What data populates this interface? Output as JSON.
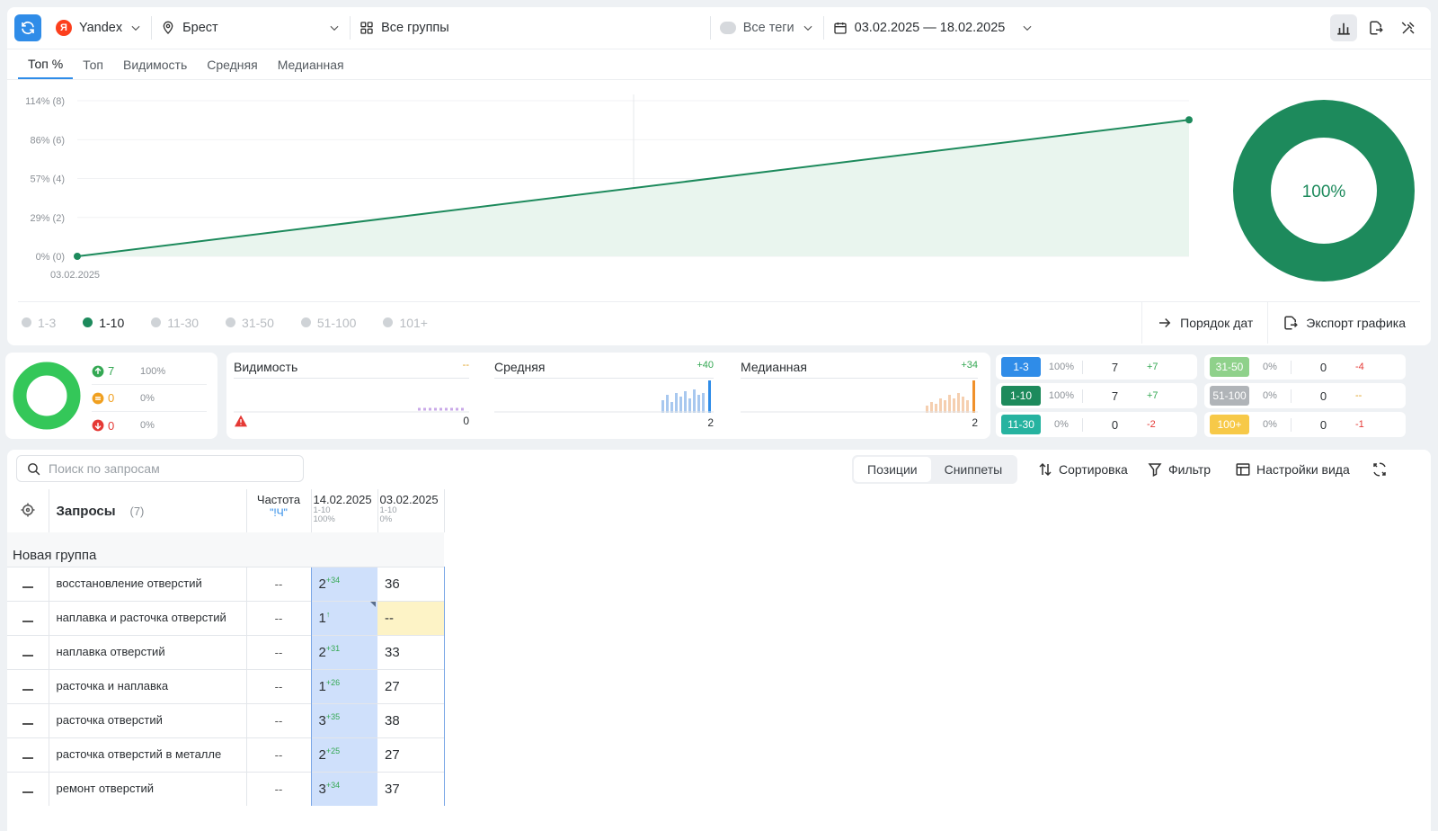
{
  "topbar": {
    "engine": "Yandex",
    "engine_logo": "Я",
    "region": "Брест",
    "groups": "Все группы",
    "tags": "Все теги",
    "date_range": "03.02.2025 — 18.02.2025"
  },
  "chart_tabs": [
    "Топ %",
    "Топ",
    "Видимость",
    "Средняя",
    "Медианная"
  ],
  "chart_data": {
    "type": "area",
    "y_ticks": [
      "114% (8)",
      "86% (6)",
      "57% (4)",
      "29% (2)",
      "0% (0)"
    ],
    "x_label_first": "03.02.2025",
    "series": [
      {
        "values": [
          0,
          100
        ]
      }
    ],
    "ylim": [
      0,
      114
    ],
    "color": "#1d8a5c",
    "donut_value": "100%"
  },
  "legend": {
    "items": [
      {
        "label": "1-3",
        "active": false
      },
      {
        "label": "1-10",
        "active": true
      },
      {
        "label": "11-30",
        "active": false
      },
      {
        "label": "31-50",
        "active": false
      },
      {
        "label": "51-100",
        "active": false
      },
      {
        "label": "101+",
        "active": false
      }
    ],
    "date_order": "Порядок дат",
    "export": "Экспорт графика"
  },
  "summary": {
    "up_count": "7",
    "up_pct": "100%",
    "same_count": "0",
    "same_pct": "0%",
    "down_count": "0",
    "down_pct": "0%"
  },
  "metrics": {
    "visibility": {
      "title": "Видимость",
      "delta": "--",
      "value": "0"
    },
    "average": {
      "title": "Средняя",
      "delta": "+40",
      "value": "2"
    },
    "median": {
      "title": "Медианная",
      "delta": "+34",
      "value": "2"
    }
  },
  "ranges": [
    {
      "label": "1-3",
      "pct": "100%",
      "count": "7",
      "delta": "+7",
      "color": "#2f8ce8",
      "delta_color": "#34a853"
    },
    {
      "label": "1-10",
      "pct": "100%",
      "count": "7",
      "delta": "+7",
      "color": "#1d8a5c",
      "delta_color": "#34a853"
    },
    {
      "label": "11-30",
      "pct": "0%",
      "count": "0",
      "delta": "-2",
      "color": "#26b3a0",
      "delta_color": "#e53935"
    },
    {
      "label": "31-50",
      "pct": "0%",
      "count": "0",
      "delta": "-4",
      "color": "#8fd18b",
      "delta_color": "#e53935"
    },
    {
      "label": "51-100",
      "pct": "0%",
      "count": "0",
      "delta": "--",
      "color": "#b0b4b8",
      "delta_color": "#e0a020"
    },
    {
      "label": "100+",
      "pct": "0%",
      "count": "0",
      "delta": "-1",
      "color": "#f7c948",
      "delta_color": "#e53935"
    }
  ],
  "table_toolbar": {
    "search_placeholder": "Поиск по запросам",
    "seg_positions": "Позиции",
    "seg_snippets": "Сниппеты",
    "sort": "Сортировка",
    "filter": "Фильтр",
    "view_settings": "Настройки вида"
  },
  "table": {
    "queries_label": "Запросы",
    "queries_count": "(7)",
    "freq_label": "Частота",
    "freq_sub": "\"!Ч\"",
    "col1_date": "14.02.2025",
    "col1_range": "1-10",
    "col1_pct": "100%",
    "col2_date": "03.02.2025",
    "col2_range": "1-10",
    "col2_pct": "0%",
    "group_name": "Новая группа",
    "rows": [
      {
        "query": "восстановление отверстий",
        "freq": "--",
        "pos": "2",
        "change": "+34",
        "prev": "36"
      },
      {
        "query": "наплавка и расточка отверстий",
        "freq": "--",
        "pos": "1",
        "change": "↑",
        "prev": "--"
      },
      {
        "query": "наплавка отверстий",
        "freq": "--",
        "pos": "2",
        "change": "+31",
        "prev": "33"
      },
      {
        "query": "расточка и наплавка",
        "freq": "--",
        "pos": "1",
        "change": "+26",
        "prev": "27"
      },
      {
        "query": "расточка отверстий",
        "freq": "--",
        "pos": "3",
        "change": "+35",
        "prev": "38"
      },
      {
        "query": "расточка отверстий в металле",
        "freq": "--",
        "pos": "2",
        "change": "+25",
        "prev": "27"
      },
      {
        "query": "ремонт отверстий",
        "freq": "--",
        "pos": "3",
        "change": "+34",
        "prev": "37"
      }
    ]
  }
}
